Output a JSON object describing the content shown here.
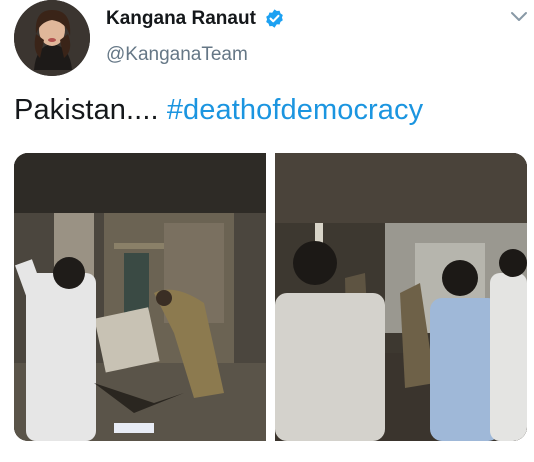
{
  "tweet": {
    "author_name": "Kangana Ranaut",
    "author_handle": "@KanganaTeam",
    "text_prefix": "Pakistan.... ",
    "hashtag": "#deathofdemocracy",
    "verified": true
  },
  "icons": {
    "verified": "verified-badge-icon",
    "more": "chevron-down-icon"
  },
  "colors": {
    "link": "#1b95e0",
    "name": "#14171a",
    "handle": "#657786",
    "verified": "#1da1f2"
  },
  "media": [
    {
      "type": "photo",
      "description_icon": "photo-left"
    },
    {
      "type": "photo",
      "description_icon": "photo-right"
    }
  ]
}
